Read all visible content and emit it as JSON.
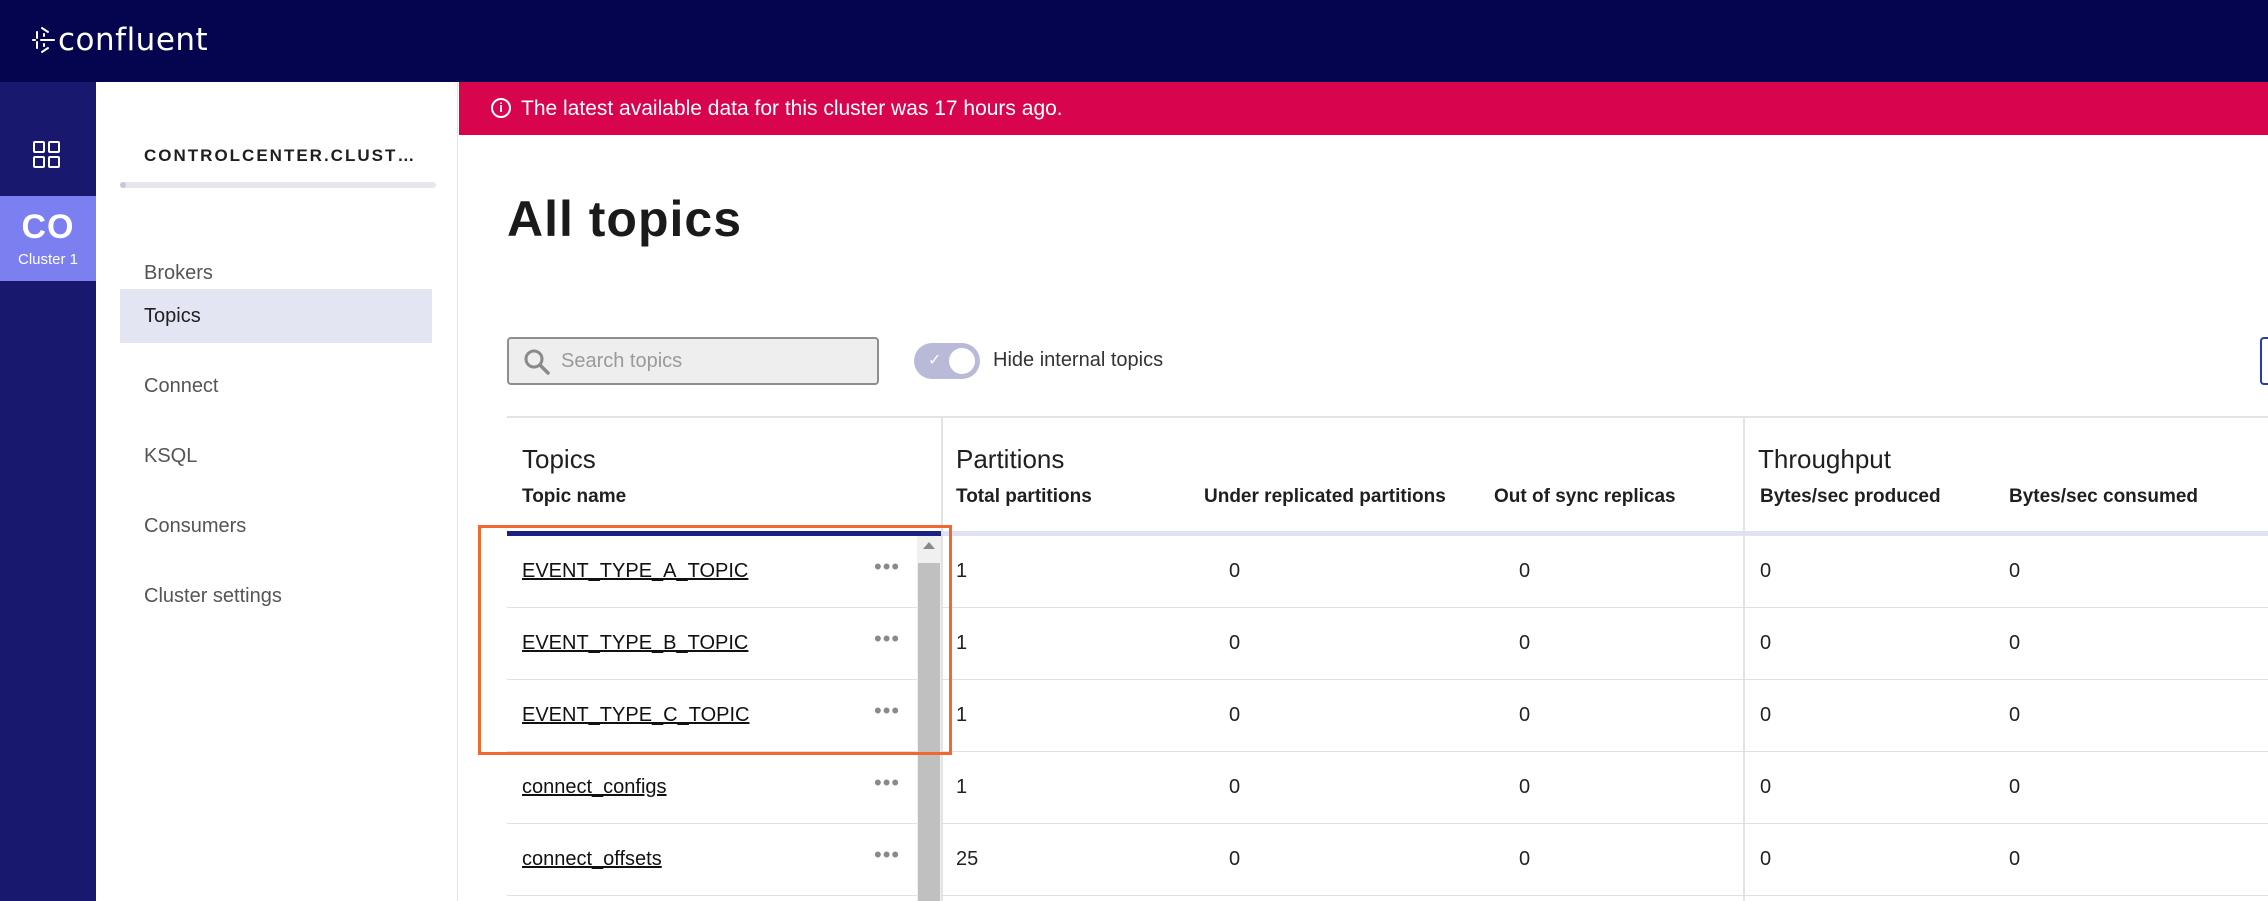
{
  "brand": {
    "name": "confluent",
    "logo_icon": "confluent-burst-icon"
  },
  "rail": {
    "home_icon": "grid-icon",
    "cluster_abbr": "CO",
    "cluster_name": "Cluster 1"
  },
  "sidenav": {
    "cluster_title": "CONTROLCENTER.CLUST…",
    "items": [
      {
        "label": "Brokers"
      },
      {
        "label": "Topics",
        "active": true
      },
      {
        "label": "Connect"
      },
      {
        "label": "KSQL"
      },
      {
        "label": "Consumers"
      },
      {
        "label": "Cluster settings"
      }
    ]
  },
  "banner": {
    "icon": "info-icon",
    "text": "The latest available data for this cluster was 17 hours ago.",
    "color": "#d8054e"
  },
  "page": {
    "title": "All topics"
  },
  "search": {
    "placeholder": "Search topics",
    "value": ""
  },
  "toggle": {
    "label": "Hide internal topics",
    "on": true
  },
  "table": {
    "groups": {
      "topics": "Topics",
      "partitions": "Partitions",
      "throughput": "Throughput"
    },
    "columns": {
      "topic_name": "Topic name",
      "total_partitions": "Total partitions",
      "under_replicated": "Under replicated partitions",
      "out_of_sync": "Out of sync replicas",
      "bytes_produced": "Bytes/sec produced",
      "bytes_consumed": "Bytes/sec consumed"
    },
    "rows": [
      {
        "name": "EVENT_TYPE_A_TOPIC",
        "total": "1",
        "under": "0",
        "oos": "0",
        "produced": "0",
        "consumed": "0"
      },
      {
        "name": "EVENT_TYPE_B_TOPIC",
        "total": "1",
        "under": "0",
        "oos": "0",
        "produced": "0",
        "consumed": "0"
      },
      {
        "name": "EVENT_TYPE_C_TOPIC",
        "total": "1",
        "under": "0",
        "oos": "0",
        "produced": "0",
        "consumed": "0"
      },
      {
        "name": "connect_configs",
        "total": "1",
        "under": "0",
        "oos": "0",
        "produced": "0",
        "consumed": "0"
      },
      {
        "name": "connect_offsets",
        "total": "25",
        "under": "0",
        "oos": "0",
        "produced": "0",
        "consumed": "0"
      }
    ],
    "row_menu": "•••"
  },
  "colors": {
    "topbar": "#04044f",
    "rail": "#18186e",
    "cluster_chip": "#7b7ff0",
    "highlight": "#f2692f"
  }
}
